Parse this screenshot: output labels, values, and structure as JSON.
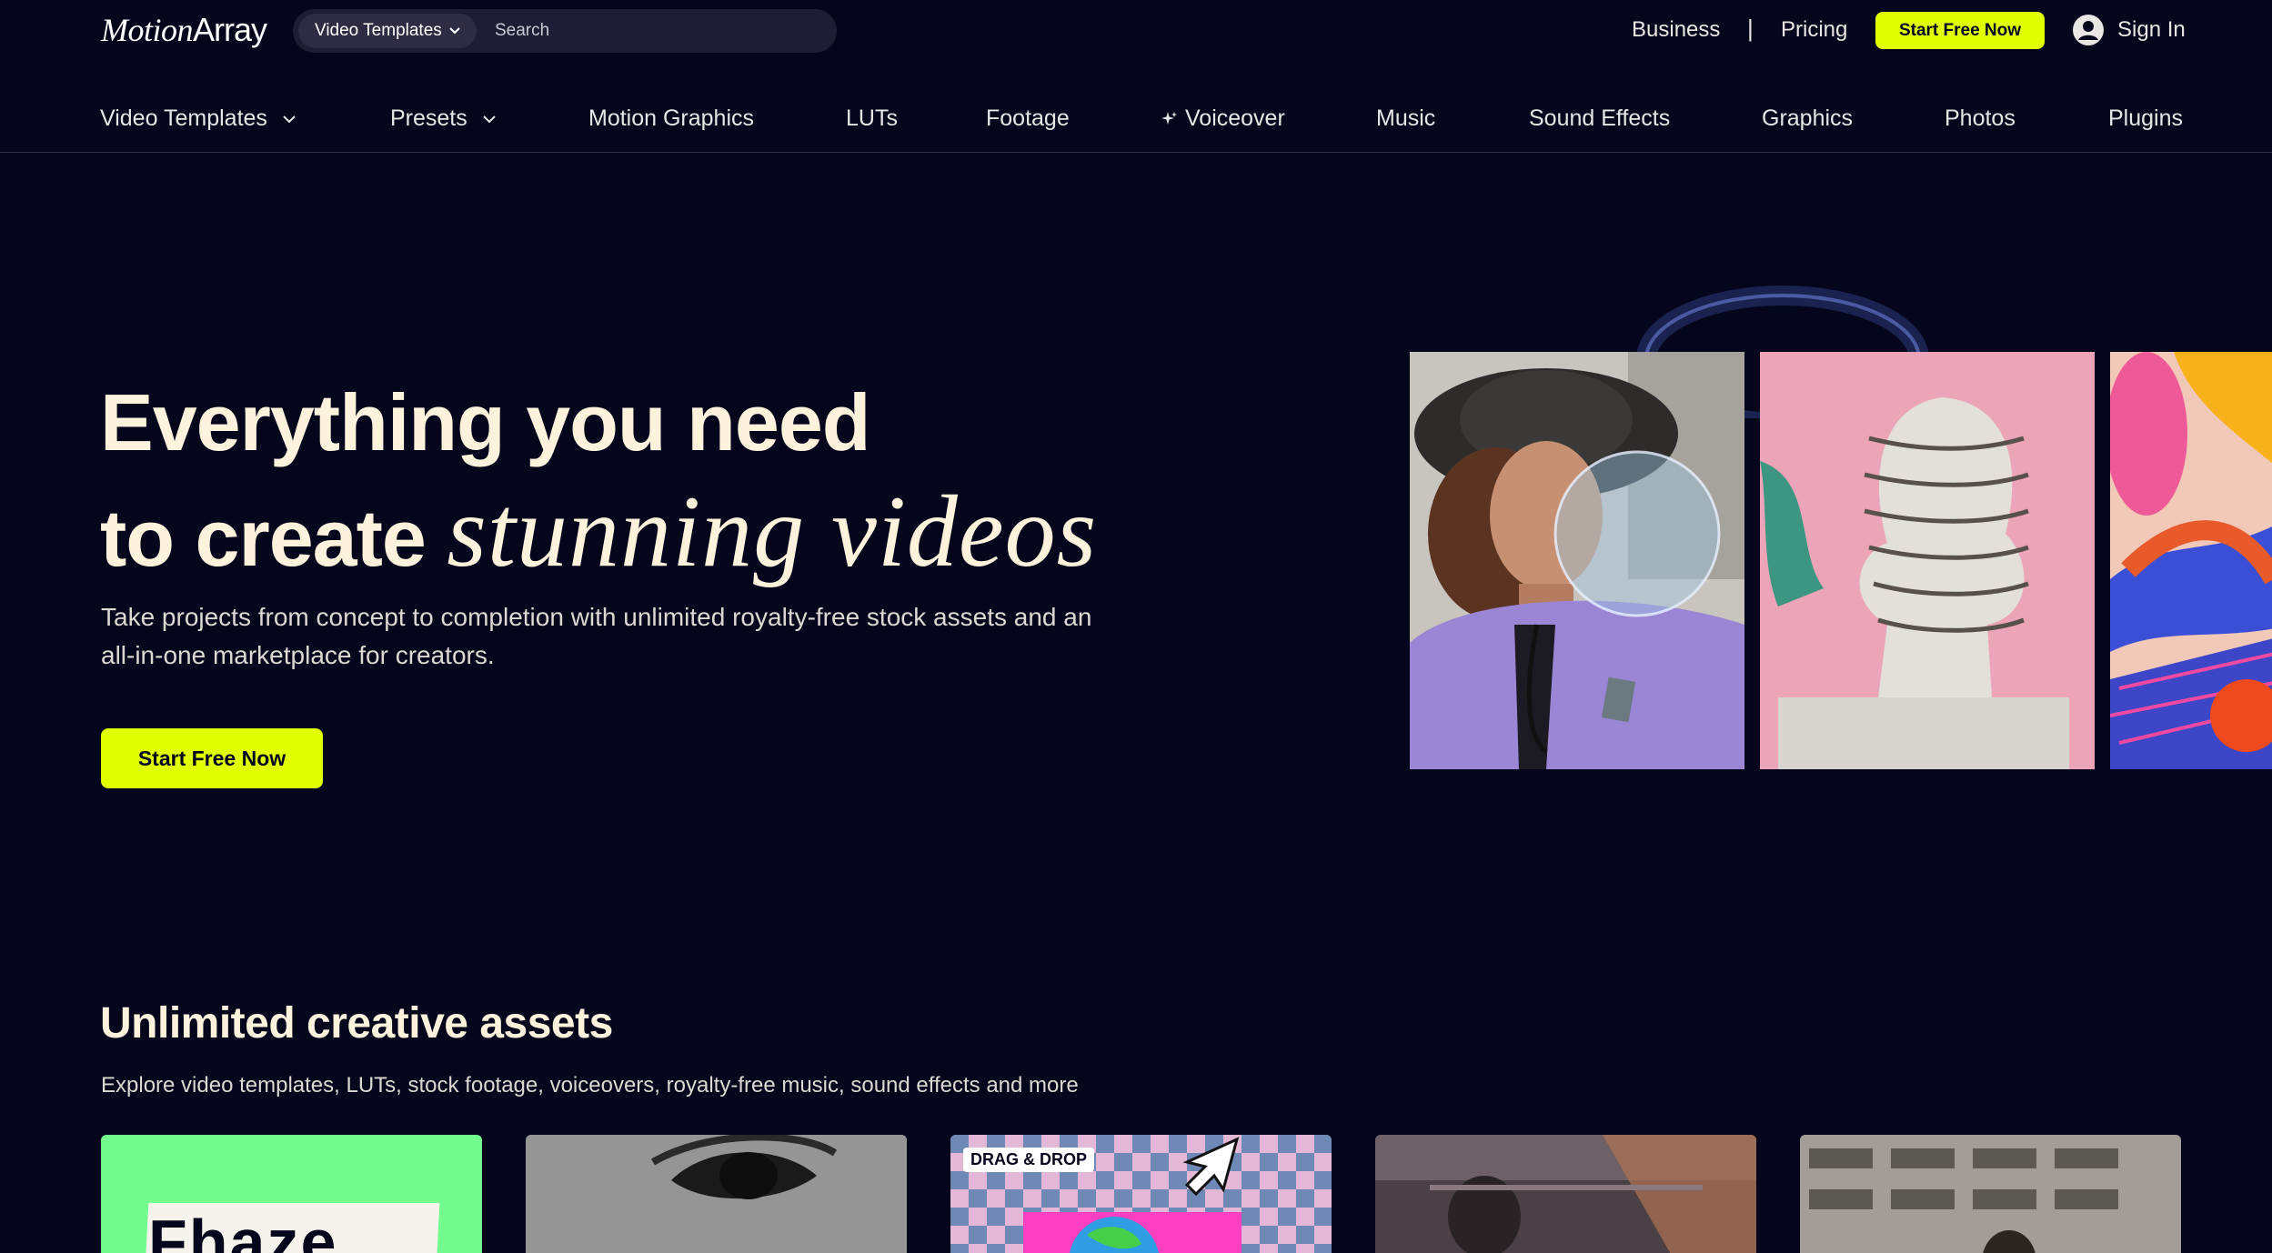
{
  "header": {
    "logo": {
      "motion": "Motion",
      "array": "Array"
    },
    "search": {
      "category_value": "Video Templates",
      "placeholder": "Search"
    },
    "links": {
      "business": "Business",
      "separator": "|",
      "pricing": "Pricing",
      "start_button": "Start Free Now",
      "sign_in": "Sign In"
    }
  },
  "nav": {
    "items": [
      {
        "label": "Video Templates",
        "has_dropdown": true
      },
      {
        "label": "Presets",
        "has_dropdown": true
      },
      {
        "label": "Motion Graphics"
      },
      {
        "label": "LUTs"
      },
      {
        "label": "Footage"
      },
      {
        "label": "Voiceover",
        "icon": "sparkle-icon"
      },
      {
        "label": "Music"
      },
      {
        "label": "Sound Effects"
      },
      {
        "label": "Graphics"
      },
      {
        "label": "Photos"
      },
      {
        "label": "Plugins"
      }
    ]
  },
  "hero": {
    "title_line1": "Everything you need",
    "title_line2_prefix": "to create ",
    "title_line2_script": "stunning videos",
    "subtitle": "Take projects from concept to completion with unlimited royalty-free stock assets and an all-in-one marketplace for creators.",
    "cta": "Start Free Now"
  },
  "assets_section": {
    "title": "Unlimited creative assets",
    "subtitle": "Explore video templates, LUTs, stock footage, voiceovers, royalty-free music, sound effects and more",
    "cards": [
      {
        "name": "green-text-card",
        "text": "Fhaze"
      },
      {
        "name": "eye-closeup-card"
      },
      {
        "name": "drag-drop-card",
        "badge": "DRAG & DROP"
      },
      {
        "name": "stage-footage-card"
      },
      {
        "name": "building-footage-card"
      }
    ]
  },
  "colors": {
    "background": "#05051c",
    "accent": "#e0ff00",
    "heading": "#fdf3dc"
  }
}
